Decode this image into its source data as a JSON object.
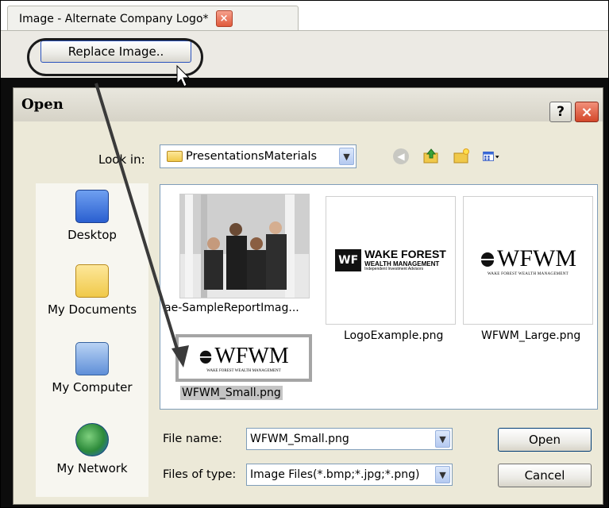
{
  "tab": {
    "title": "Image - Alternate Company Logo*",
    "close_glyph": "×"
  },
  "toolbar": {
    "replace_label": "Replace Image.."
  },
  "dialog": {
    "title": "Open",
    "help_label": "?",
    "close_glyph": "×",
    "look_in_label": "Look in:",
    "look_in_value": "PresentationsMaterials",
    "toolbar_icons": [
      "back-icon",
      "up-folder-icon",
      "new-folder-icon",
      "views-menu-icon"
    ]
  },
  "places": [
    {
      "label": "Desktop",
      "icon": "desktop-icon"
    },
    {
      "label": "My Documents",
      "icon": "my-documents-icon"
    },
    {
      "label": "My Computer",
      "icon": "my-computer-icon"
    },
    {
      "label": "My Network",
      "icon": "my-network-icon"
    }
  ],
  "files": [
    {
      "name": "ae-SampleReportImag...",
      "kind": "photo"
    },
    {
      "name": "LogoExample.png",
      "logo_main": "WF",
      "logo_line1": "WAKE FOREST",
      "logo_line2": "WEALTH MANAGEMENT",
      "logo_line3": "Independent Investment Advisors"
    },
    {
      "name": "WFWM_Large.png",
      "logo_big": "WFWM",
      "logo_sub": "WAKE FOREST WEALTH MANAGEMENT"
    },
    {
      "name": "WFWM_Small.png",
      "logo_big": "WFWM",
      "logo_sub": "WAKE FOREST WEALTH MANAGEMENT",
      "selected": true
    }
  ],
  "form": {
    "file_name_label": "File name:",
    "file_name_value": "WFWM_Small.png",
    "files_of_type_label": "Files of type:",
    "files_of_type_value": "Image Files(*.bmp;*.jpg;*.png)",
    "open_label": "Open",
    "cancel_label": "Cancel"
  },
  "colors": {
    "accent": "#2a52be",
    "close_red": "#d3472a",
    "dialog_bg": "#ece9d8"
  }
}
